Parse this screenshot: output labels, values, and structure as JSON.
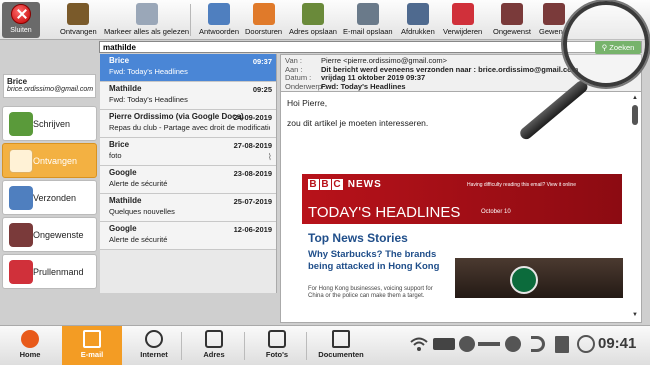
{
  "toolbar": {
    "close_label": "Sluiten",
    "buttons": [
      {
        "label": "Ontvangen",
        "color": "#7a5a2a"
      },
      {
        "label": "Markeer alles als gelezen",
        "color": "#9aa7b8"
      },
      {
        "label": "Antwoorden",
        "color": "#4f7fbf"
      },
      {
        "label": "Doorsturen",
        "color": "#e07a2a"
      },
      {
        "label": "Adres opslaan",
        "color": "#6a8a3a"
      },
      {
        "label": "E-mail opslaan",
        "color": "#6a7a8a"
      },
      {
        "label": "Afdrukken",
        "color": "#4f6a8f"
      },
      {
        "label": "Verwijderen",
        "color": "#d0303a"
      },
      {
        "label": "Ongewenst",
        "color": "#7a3a3a"
      },
      {
        "label": "Gewenst",
        "color": "#7a3a3a"
      }
    ]
  },
  "search": {
    "value": "mathilde",
    "button": "Zoeken"
  },
  "account": {
    "name": "Brice",
    "email": "brice.ordissimo@gmail.com"
  },
  "folders": [
    {
      "label": "Schrijven",
      "color": "#5a9a3a"
    },
    {
      "label": "Ontvangen",
      "color": "#c97a20"
    },
    {
      "label": "Verzonden",
      "color": "#4f7fbf"
    },
    {
      "label": "Ongewenste",
      "color": "#7a3a3a"
    },
    {
      "label": "Prullenmand",
      "color": "#d0303a"
    }
  ],
  "messages": [
    {
      "from": "Brice",
      "date": "09:37",
      "subject": "Fwd: Today's Headlines",
      "selected": true
    },
    {
      "from": "Mathilde",
      "date": "09:25",
      "subject": "Fwd: Today's Headlines"
    },
    {
      "from": "Pierre Ordissimo (via Google Docs)",
      "date": "24-09-2019",
      "subject": "Repas du club - Partage avec droit de modification"
    },
    {
      "from": "Brice",
      "date": "27-08-2019",
      "subject": "foto",
      "attachment": true
    },
    {
      "from": "Google",
      "date": "23-08-2019",
      "subject": "Alerte de sécurité"
    },
    {
      "from": "Mathilde",
      "date": "25-07-2019",
      "subject": "Quelques nouvelles"
    },
    {
      "from": "Google",
      "date": "12-06-2019",
      "subject": "Alerte de sécurité"
    }
  ],
  "header": {
    "from_k": "Van :",
    "from_v": "Pierre <pierre.ordissimo@gmail.com>",
    "to_k": "Aan :",
    "to_v": "Dit bericht werd eveneens verzonden naar : brice.ordissimo@gmail.com",
    "date_k": "Datum :",
    "date_v": "vrijdag 11 oktober 2019 09:37",
    "subj_k": "Onderwerp :",
    "subj_v": "Fwd: Today's Headlines"
  },
  "body": {
    "greeting": "Hoi Pierre,",
    "line": "zou dit artikel je moeten interesseren."
  },
  "newsletter": {
    "logo_b1": "B",
    "logo_b2": "B",
    "logo_b3": "C",
    "logo_news": "NEWS",
    "trouble": "Having difficulty reading this email? View it online",
    "headline": "TODAY'S HEADLINES",
    "date": "October 10",
    "top_news": "Top News Stories",
    "story_title": "Why Starbucks? The brands being attacked in Hong Kong",
    "story_summary": "For Hong Kong businesses, voicing support for China or the police can make them a target."
  },
  "taskbar": {
    "items": [
      {
        "label": "Home"
      },
      {
        "label": "E-mail",
        "active": true
      },
      {
        "label": "Internet"
      },
      {
        "label": "Adres"
      },
      {
        "label": "Foto's"
      },
      {
        "label": "Documenten"
      }
    ],
    "time": "09:41"
  }
}
